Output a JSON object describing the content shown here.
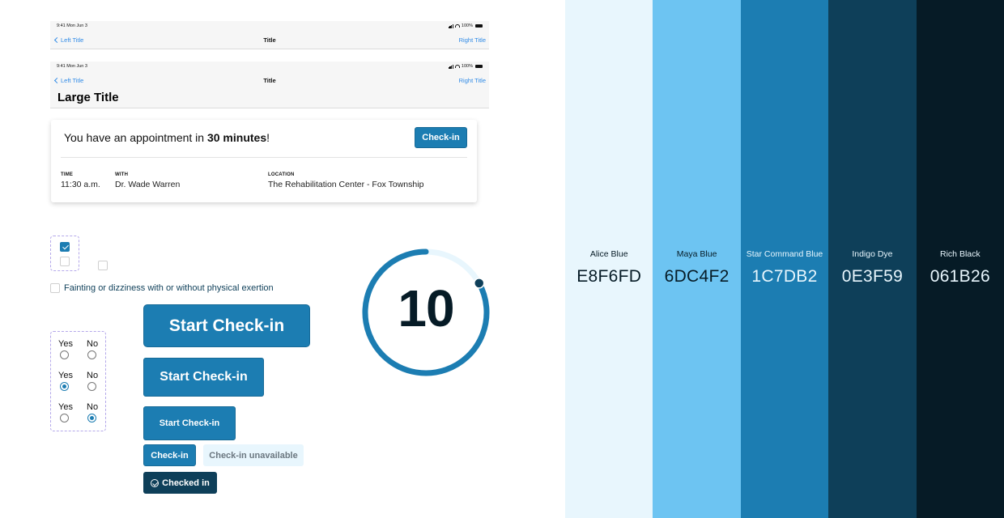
{
  "navbars": [
    {
      "status_time": "9:41 Mon Jun 3",
      "battery": "100%",
      "left_title": "Left Title",
      "title": "Title",
      "right_title": "Right Title"
    },
    {
      "status_time": "9:41 Mon Jun 3",
      "battery": "100%",
      "left_title": "Left Title",
      "title": "Title",
      "right_title": "Right Title",
      "large_title": "Large Title"
    }
  ],
  "appointment": {
    "message_prefix": "You have an appointment in ",
    "message_bold": "30 minutes",
    "message_suffix": "!",
    "checkin_label": "Check-in",
    "fields": [
      {
        "label": "TIME",
        "value": "11:30 a.m."
      },
      {
        "label": "WITH",
        "value": "Dr. Wade Warren"
      },
      {
        "label": "LOCATION",
        "value": "The Rehabilitation Center - Fox Township"
      }
    ]
  },
  "checkboxes": {
    "group": [
      {
        "checked": true
      },
      {
        "checked": false
      }
    ],
    "standalone_checked": false,
    "labeled": {
      "label": "Fainting or dizziness with or without physical exertion",
      "checked": false
    }
  },
  "radios": {
    "yes_label": "Yes",
    "no_label": "No",
    "rows": [
      {
        "selected": null
      },
      {
        "selected": "yes"
      },
      {
        "selected": "no"
      }
    ]
  },
  "buttons": {
    "start_xl": "Start Check-in",
    "start_l": "Start Check-in",
    "start_m": "Start Check-in",
    "checkin": "Check-in",
    "unavailable": "Check-in unavailable",
    "checked_in": "Checked in"
  },
  "countdown": {
    "value": "10",
    "progress": 0.83,
    "colors": {
      "track": "#E8F6FD",
      "fill": "#1C7DB2",
      "dot": "#0E3F59"
    }
  },
  "palette": [
    {
      "name": "Alice Blue",
      "hex": "E8F6FD",
      "color": "#E8F6FD",
      "text": "#061B26"
    },
    {
      "name": "Maya Blue",
      "hex": "6DC4F2",
      "color": "#6DC4F2",
      "text": "#061B26"
    },
    {
      "name": "Star Command Blue",
      "hex": "1C7DB2",
      "color": "#1C7DB2",
      "text": "#E8F6FD"
    },
    {
      "name": "Indigo Dye",
      "hex": "0E3F59",
      "color": "#0E3F59",
      "text": "#E8F6FD"
    },
    {
      "name": "Rich Black",
      "hex": "061B26",
      "color": "#061B26",
      "text": "#E8F6FD"
    }
  ]
}
